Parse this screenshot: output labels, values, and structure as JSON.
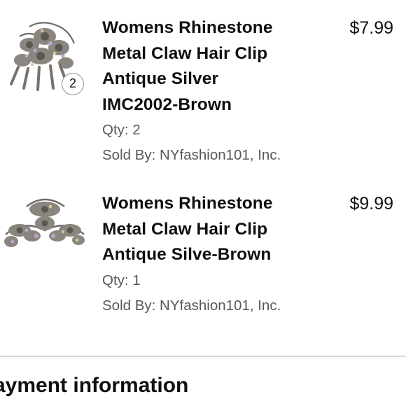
{
  "order_items": [
    {
      "title_lines": [
        "Womens Rhinestone",
        "Metal Claw Hair Clip",
        "Antique Silver",
        "IMC2002-Brown"
      ],
      "price": "$7.99",
      "quantity_badge": "2",
      "quantity_text": "Qty: 2",
      "sold_by": "Sold By: NYfashion101, Inc.",
      "image_icon": "rhinestone-hair-claw-clip"
    },
    {
      "title_lines": [
        "Womens Rhinestone",
        "Metal Claw Hair Clip",
        "Antique Silve-Brown"
      ],
      "price": "$9.99",
      "quantity_text": "Qty: 1",
      "sold_by": "Sold By: NYfashion101, Inc.",
      "image_icon": "rhinestone-hair-claw-clip"
    }
  ],
  "payment_section": {
    "heading": "ayment information"
  },
  "colors": {
    "text_primary": "#0f1111",
    "text_secondary": "#565959",
    "divider": "#d5d9d9"
  }
}
